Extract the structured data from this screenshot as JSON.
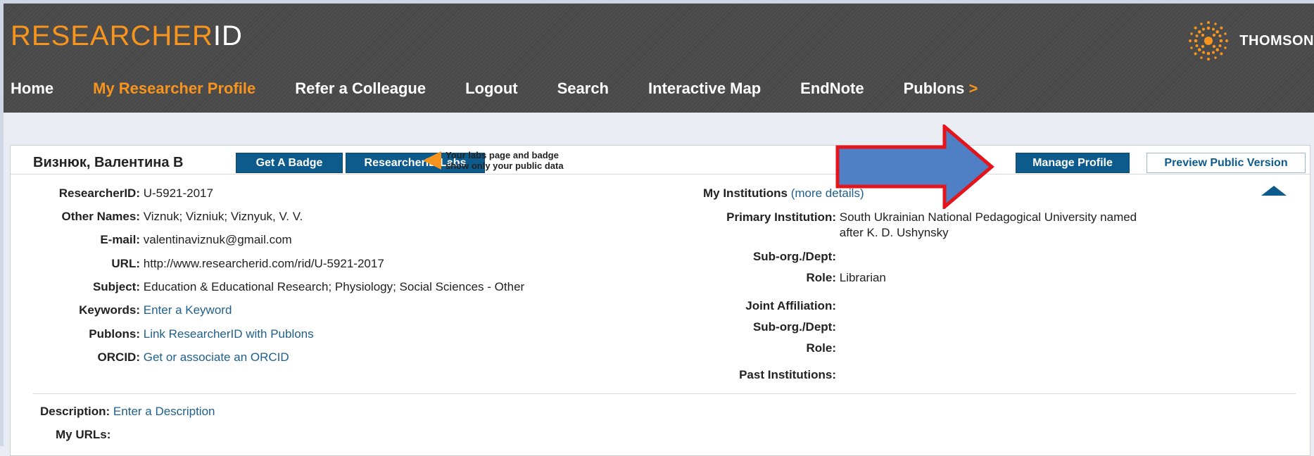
{
  "logo": {
    "text_orange": "RESEARCHER",
    "text_white": "ID"
  },
  "brand": {
    "name": "THOMSON"
  },
  "nav": {
    "items": [
      {
        "label": "Home",
        "active": false
      },
      {
        "label": "My Researcher Profile",
        "active": true
      },
      {
        "label": "Refer a Colleague",
        "active": false
      },
      {
        "label": "Logout",
        "active": false
      },
      {
        "label": "Search",
        "active": false
      },
      {
        "label": "Interactive Map",
        "active": false
      },
      {
        "label": "EndNote",
        "active": false
      },
      {
        "label": "Publons",
        "active": false,
        "suffix": ">"
      }
    ]
  },
  "profile": {
    "name": "Визнюк, Валентина В",
    "buttons": {
      "badge": "Get A Badge",
      "labs": "ResearcherID Labs",
      "manage": "Manage Profile",
      "preview": "Preview Public Version"
    },
    "labs_note": {
      "line1": "Your labs page and badge",
      "line2": "show only your public data"
    }
  },
  "details": {
    "researcher_id": {
      "label": "ResearcherID:",
      "value": "U-5921-2017"
    },
    "other_names": {
      "label": "Other Names:",
      "value": "Viznuk; Vizniuk; Viznyuk, V. V."
    },
    "email": {
      "label": "E-mail:",
      "value": "valentinaviznuk@gmail.com"
    },
    "url": {
      "label": "URL:",
      "value": "http://www.researcherid.com/rid/U-5921-2017"
    },
    "subject": {
      "label": "Subject:",
      "value": "Education & Educational Research; Physiology; Social Sciences - Other"
    },
    "keywords": {
      "label": "Keywords:",
      "value": "Enter a Keyword"
    },
    "publons": {
      "label": "Publons:",
      "value": "Link ResearcherID with Publons"
    },
    "orcid": {
      "label": "ORCID:",
      "value": "Get or associate an ORCID"
    }
  },
  "institutions": {
    "title": "My Institutions",
    "more_link": "(more details)",
    "primary": {
      "label": "Primary Institution:",
      "line1": "South Ukrainian National Pedagogical University named",
      "line2": "after K. D. Ushynsky"
    },
    "sub_org": {
      "label": "Sub-org./Dept:",
      "value": ""
    },
    "role": {
      "label": "Role:",
      "value": "Librarian"
    },
    "joint": {
      "label": "Joint Affiliation:"
    },
    "joint_sub_org": {
      "label": "Sub-org./Dept:"
    },
    "joint_role": {
      "label": "Role:"
    },
    "past": {
      "label": "Past Institutions:"
    }
  },
  "description": {
    "label": "Description:",
    "value": "Enter a Description"
  },
  "my_urls": {
    "label": "My URLs:"
  },
  "colors": {
    "accent": "#f7941d",
    "button": "#0d5b8c",
    "header": "#4a4a4a",
    "arrow_fill": "#4f7fc4",
    "arrow_stroke": "#e3141b"
  }
}
